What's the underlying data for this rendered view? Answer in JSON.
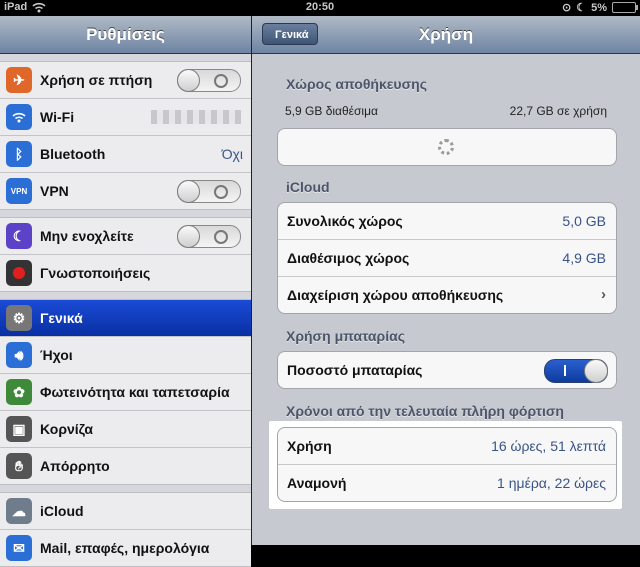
{
  "status": {
    "device": "iPad",
    "time": "20:50",
    "battery": "5%"
  },
  "sidebar": {
    "title": "Ρυθμίσεις",
    "groups": [
      [
        {
          "label": "Χρήση σε πτήση",
          "icon": "airplane-icon",
          "toggle": "off"
        },
        {
          "label": "Wi-Fi",
          "icon": "wifi-icon"
        },
        {
          "label": "Bluetooth",
          "icon": "bluetooth-icon",
          "value": "Όχι"
        },
        {
          "label": "VPN",
          "icon": "vpn-icon",
          "toggle": "off"
        }
      ],
      [
        {
          "label": "Μην ενοχλείτε",
          "icon": "moon-icon",
          "toggle": "off"
        },
        {
          "label": "Γνωστοποιήσεις",
          "icon": "notifications-icon"
        }
      ],
      [
        {
          "label": "Γενικά",
          "icon": "gear-icon",
          "selected": true
        },
        {
          "label": "Ήχοι",
          "icon": "speaker-icon"
        },
        {
          "label": "Φωτεινότητα και ταπετσαρία",
          "icon": "flower-icon"
        },
        {
          "label": "Κορνίζα",
          "icon": "picture-frame-icon"
        },
        {
          "label": "Απόρρητο",
          "icon": "hand-icon"
        }
      ],
      [
        {
          "label": "iCloud",
          "icon": "cloud-icon"
        },
        {
          "label": "Mail, επαφές, ημερολόγια",
          "icon": "mail-icon"
        }
      ]
    ]
  },
  "detail": {
    "back_label": "Γενικά",
    "title": "Χρήση",
    "storage": {
      "header": "Χώρος αποθήκευσης",
      "available": "5,9 GB διαθέσιμα",
      "used": "22,7 GB σε χρήση"
    },
    "icloud": {
      "header": "iCloud",
      "rows": [
        {
          "label": "Συνολικός χώρος",
          "value": "5,0 GB"
        },
        {
          "label": "Διαθέσιμος χώρος",
          "value": "4,9 GB"
        },
        {
          "label": "Διαχείριση χώρου αποθήκευσης",
          "value": ""
        }
      ]
    },
    "battery": {
      "header": "Χρήση μπαταρίας",
      "percent_label": "Ποσοστό μπαταρίας",
      "percent_on": true
    },
    "since_charge": {
      "header": "Χρόνοι από την τελευταία πλήρη φόρτιση",
      "rows": [
        {
          "label": "Χρήση",
          "value": "16 ώρες, 51 λεπτά"
        },
        {
          "label": "Αναμονή",
          "value": "1 ημέρα, 22 ώρες"
        }
      ]
    }
  }
}
